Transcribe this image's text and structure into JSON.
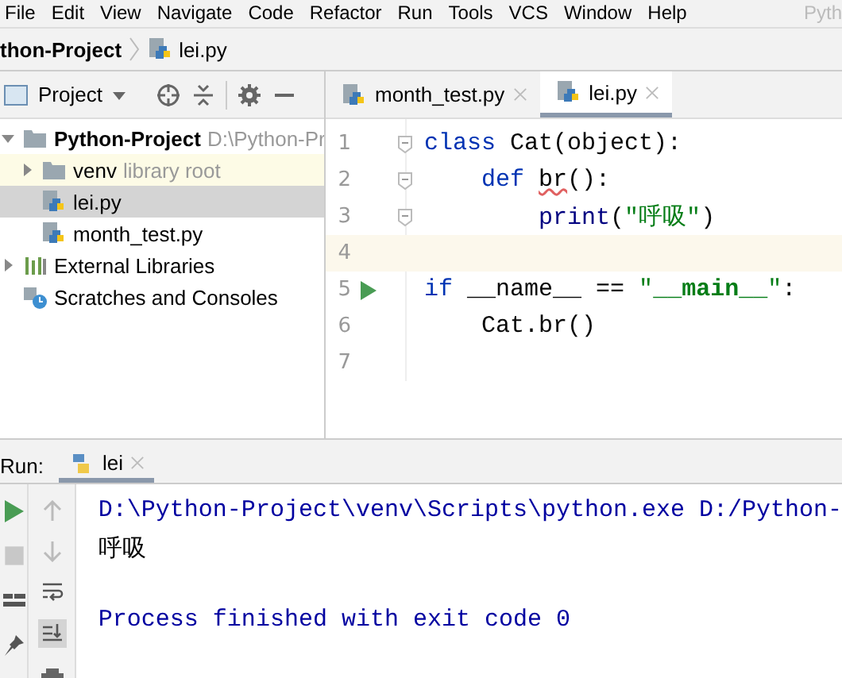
{
  "menu": [
    {
      "label": "File"
    },
    {
      "label": "Edit"
    },
    {
      "label": "View"
    },
    {
      "label": "Navigate"
    },
    {
      "label": "Code"
    },
    {
      "label": "Refactor"
    },
    {
      "label": "Run"
    },
    {
      "label": "Tools"
    },
    {
      "label": "VCS"
    },
    {
      "label": "Window"
    },
    {
      "label": "Help"
    }
  ],
  "window_title": "Pyth",
  "breadcrumb": [
    {
      "label": "thon-Project",
      "kind": "project"
    },
    {
      "label": "lei.py",
      "kind": "file"
    }
  ],
  "project_panel": {
    "title": "Project",
    "tree": [
      {
        "label": "Python-Project",
        "note": "D:\\Python-Pr",
        "kind": "folder",
        "expanded": true,
        "selected": false,
        "children": [
          {
            "label": "venv",
            "note": "library root",
            "kind": "folder",
            "expanded": false,
            "selected": false
          },
          {
            "label": "lei.py",
            "kind": "python",
            "selected": true
          },
          {
            "label": "month_test.py",
            "kind": "python",
            "selected": false
          }
        ]
      },
      {
        "label": "External Libraries",
        "kind": "libraries",
        "expanded": false,
        "selected": false
      },
      {
        "label": "Scratches and Consoles",
        "kind": "scratches",
        "selected": false
      }
    ]
  },
  "editor_tabs": [
    {
      "label": "month_test.py",
      "selected": false
    },
    {
      "label": "lei.py",
      "selected": true
    }
  ],
  "code_lines": [
    {
      "number": "1",
      "fold": true,
      "run": false,
      "current": false,
      "tokens": [
        {
          "text": "class ",
          "kind": "keyword"
        },
        {
          "text": "Cat(object):",
          "kind": "plain"
        }
      ]
    },
    {
      "number": "2",
      "fold": true,
      "run": false,
      "current": false,
      "tokens": [
        {
          "text": "    def ",
          "kind": "keyword"
        },
        {
          "text": "br",
          "kind": "warn"
        },
        {
          "text": "():",
          "kind": "plain"
        }
      ]
    },
    {
      "number": "3",
      "fold": true,
      "run": false,
      "current": false,
      "tokens": [
        {
          "text": "        print",
          "kind": "builtin"
        },
        {
          "text": "(",
          "kind": "plain"
        },
        {
          "text": "\"呼吸\"",
          "kind": "string"
        },
        {
          "text": ")",
          "kind": "plain"
        }
      ]
    },
    {
      "number": "4",
      "fold": false,
      "run": false,
      "current": true
    },
    {
      "number": "5",
      "fold": false,
      "run": true,
      "current": false,
      "tokens": [
        {
          "text": "if ",
          "kind": "keyword"
        },
        {
          "text": "__name__ == ",
          "kind": "plain"
        },
        {
          "text": "\"",
          "kind": "string"
        },
        {
          "text": "__main__",
          "kind": "dunder"
        },
        {
          "text": "\"",
          "kind": "string"
        },
        {
          "text": ":",
          "kind": "plain"
        }
      ]
    },
    {
      "number": "6",
      "fold": false,
      "run": false,
      "current": false,
      "tokens": [
        {
          "text": "    Cat.br()",
          "kind": "plain"
        }
      ]
    },
    {
      "number": "7",
      "fold": false,
      "run": false,
      "current": false
    }
  ],
  "run_panel": {
    "label": "Run:",
    "tabs": [
      {
        "label": "lei",
        "selected": true
      }
    ],
    "output": [
      {
        "text": "D:\\Python-Project\\venv\\Scripts\\python.exe D:/Python-",
        "kind": "system"
      },
      {
        "text": "呼吸",
        "kind": "stdout"
      },
      {
        "text": "Process finished with exit code 0",
        "kind": "exit"
      }
    ]
  }
}
